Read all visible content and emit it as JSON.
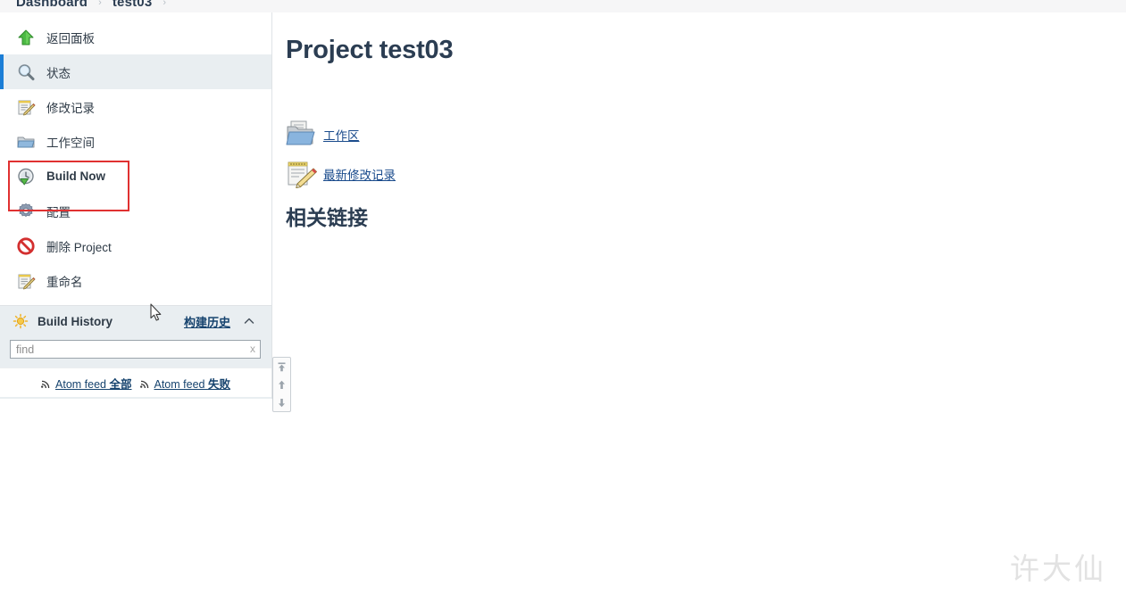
{
  "breadcrumb": {
    "items": [
      "Dashboard",
      "test03"
    ],
    "separator": "›",
    "trailing_separator": "›"
  },
  "sidebar": {
    "tasks": [
      {
        "label": "返回面板",
        "icon": "up-arrow-green-icon",
        "active": false,
        "latin": false
      },
      {
        "label": "状态",
        "icon": "magnifier-icon",
        "active": true,
        "latin": false
      },
      {
        "label": "修改记录",
        "icon": "notepad-pencil-icon",
        "active": false,
        "latin": false
      },
      {
        "label": "工作空间",
        "icon": "folder-icon",
        "active": false,
        "latin": false
      },
      {
        "label": "Build Now",
        "icon": "build-clock-play-icon",
        "active": false,
        "latin": true
      },
      {
        "label": "配置",
        "icon": "gear-icon",
        "active": false,
        "latin": false
      },
      {
        "label": "删除 Project",
        "icon": "delete-forbidden-icon",
        "active": false,
        "latin": false
      },
      {
        "label": "重命名",
        "icon": "notepad-pencil-icon",
        "active": false,
        "latin": false
      }
    ],
    "highlighted_task": "Build Now",
    "highlight_color": "#e03131",
    "build_history": {
      "title": "Build History",
      "icon": "sun-icon",
      "link_label": "构建历史",
      "collapse_icon": "chevron-up-icon",
      "find": {
        "value": "",
        "placeholder": "find",
        "clear_label": "x"
      },
      "feeds": [
        {
          "icon": "rss-icon",
          "prefix": "Atom feed ",
          "suffix": "全部"
        },
        {
          "icon": "rss-icon",
          "prefix": "Atom feed ",
          "suffix": "失败"
        }
      ]
    }
  },
  "scroll_nav": {
    "buttons": [
      "jump-to-top",
      "scroll-up",
      "scroll-down"
    ]
  },
  "main": {
    "title": "Project test03",
    "links": [
      {
        "label": "工作区",
        "icon": "workspace-folder-icon"
      },
      {
        "label": "最新修改记录",
        "icon": "changes-notepad-icon"
      }
    ],
    "section_heading": "相关链接"
  },
  "watermark": {
    "text": "许大仙"
  },
  "colors": {
    "accent_blue": "#1c7ed6",
    "link_blue": "#1a4b8c",
    "sidebar_panel": "#e9eef1",
    "highlight_red": "#e03131",
    "title_navy": "#2b3d52"
  }
}
